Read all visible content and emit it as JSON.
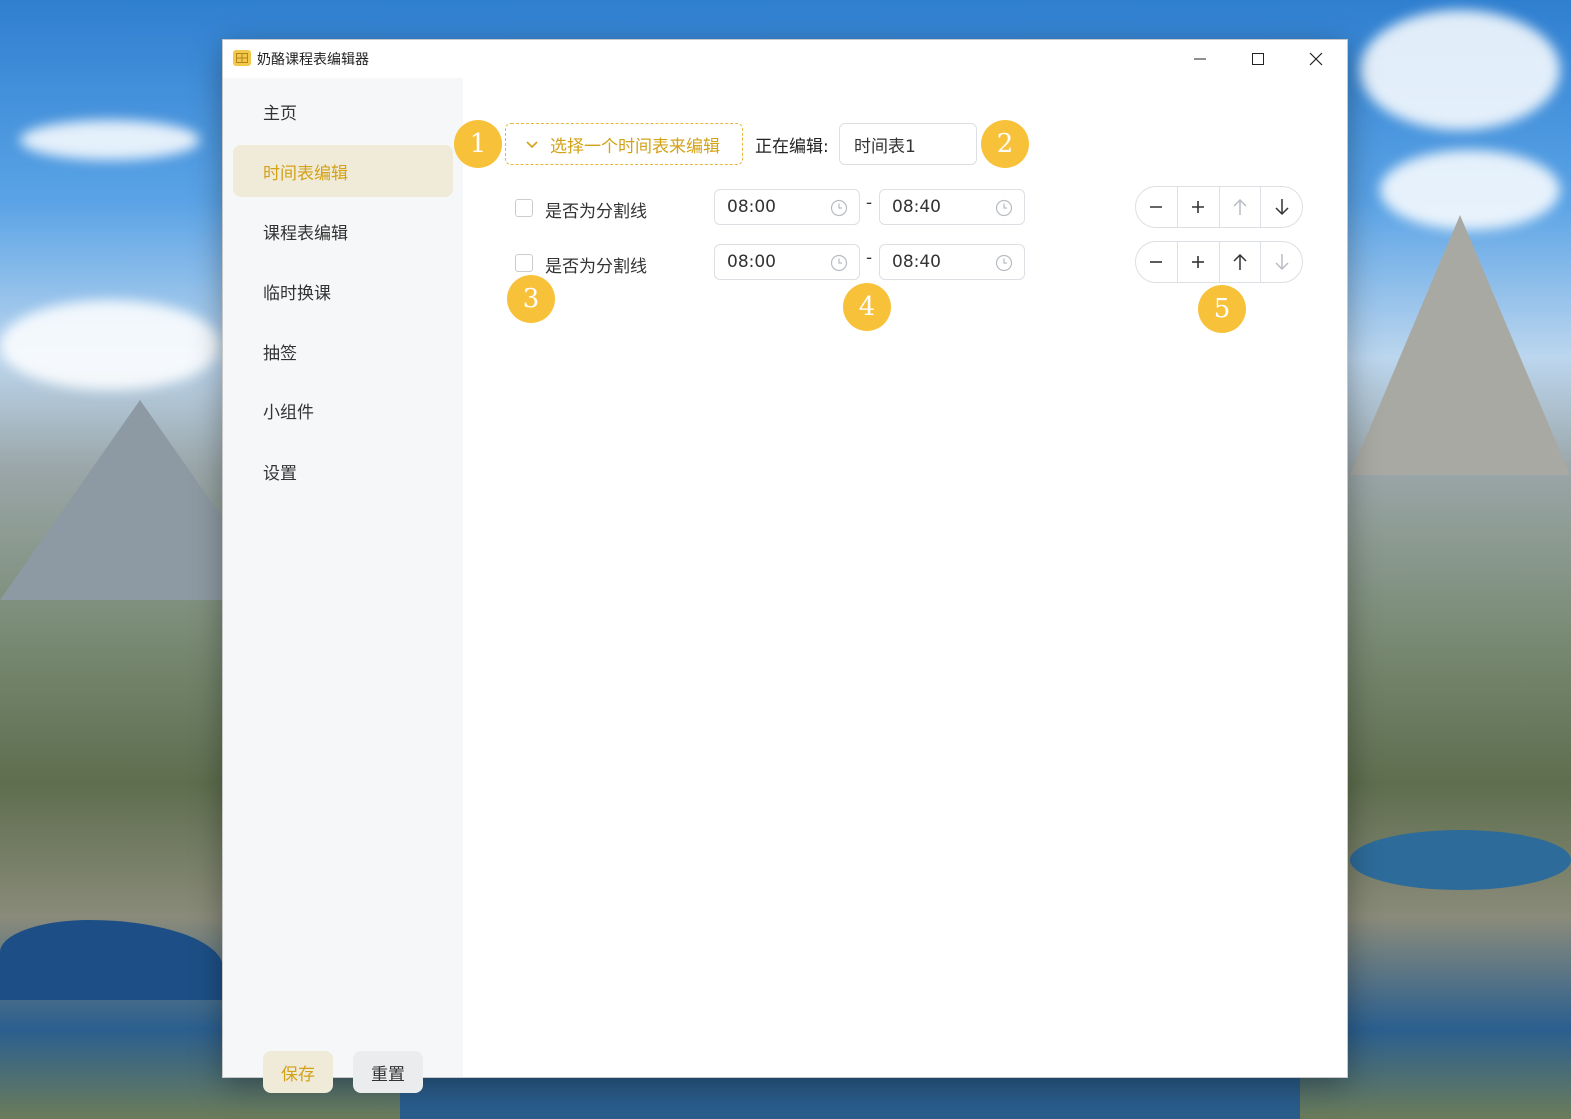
{
  "window": {
    "title": "奶酪课程表编辑器",
    "controls": [
      "minimize",
      "maximize",
      "close"
    ]
  },
  "sidebar": {
    "items": [
      {
        "label": "主页",
        "active": false
      },
      {
        "label": "时间表编辑",
        "active": true
      },
      {
        "label": "课程表编辑",
        "active": false
      },
      {
        "label": "临时换课",
        "active": false
      },
      {
        "label": "抽签",
        "active": false
      },
      {
        "label": "小组件",
        "active": false
      },
      {
        "label": "设置",
        "active": false
      }
    ],
    "save_label": "保存",
    "reset_label": "重置"
  },
  "editor": {
    "select_placeholder": "选择一个时间表来编辑",
    "editing_label": "正在编辑:",
    "timetable_name": "时间表1",
    "rows": [
      {
        "divider_label": "是否为分割线",
        "divider_checked": false,
        "start": "08:00",
        "end": "08:40",
        "dash": "-"
      },
      {
        "divider_label": "是否为分割线",
        "divider_checked": false,
        "start": "08:00",
        "end": "08:40",
        "dash": "-"
      }
    ]
  },
  "callouts": [
    "1",
    "2",
    "3",
    "4",
    "5"
  ],
  "colors": {
    "accent": "#d3a217",
    "accent_bg": "#f0ead8",
    "badge": "#f8c13a",
    "sidebar_bg": "#f6f7f8"
  }
}
